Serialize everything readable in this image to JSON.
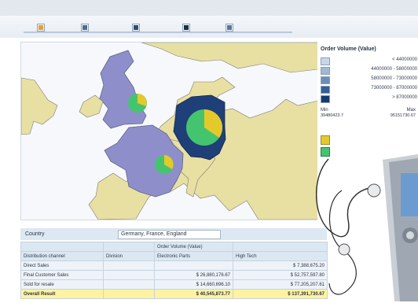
{
  "legend": {
    "title": "Order Volume (Value)",
    "rows": [
      {
        "label": "< 44000000",
        "color": "#c8d7e8"
      },
      {
        "label": "44000000 - 58000000",
        "color": "#9fb8d6"
      },
      {
        "label": "58000000 - 73000000",
        "color": "#6b8eb9"
      },
      {
        "label": "73000000 - 87000000",
        "color": "#355f98"
      },
      {
        "label": "> 87000000",
        "color": "#173a72"
      }
    ],
    "min_label": "Min",
    "max_label": "Max",
    "min_value": "39480423.7",
    "max_value": "95151730.67",
    "series_colors": [
      "#e5c92a",
      "#45c46f"
    ]
  },
  "filter": {
    "label": "Country",
    "value": "Germany, France, England"
  },
  "table": {
    "header1": [
      "",
      "",
      "Order Volume (Value)",
      ""
    ],
    "header2": [
      "Distribution channel",
      "Division",
      "Electronic Parts",
      "High Tech"
    ],
    "rows": [
      {
        "name": "Direct Sales",
        "division": "",
        "electronic": "",
        "hightech": "$ 7,388,675.20"
      },
      {
        "name": "Final Customer Sales",
        "division": "",
        "electronic": "$ 26,880,176.67",
        "hightech": "$ 52,757,597.80"
      },
      {
        "name": "Sold for resale",
        "division": "",
        "electronic": "$ 14,660,696.10",
        "hightech": "$ 77,205,207.61"
      }
    ],
    "total": {
      "name": "Overall Result",
      "division": "",
      "electronic": "$ 40,545,873.77",
      "hightech": "$ 137,391,730.67"
    }
  }
}
